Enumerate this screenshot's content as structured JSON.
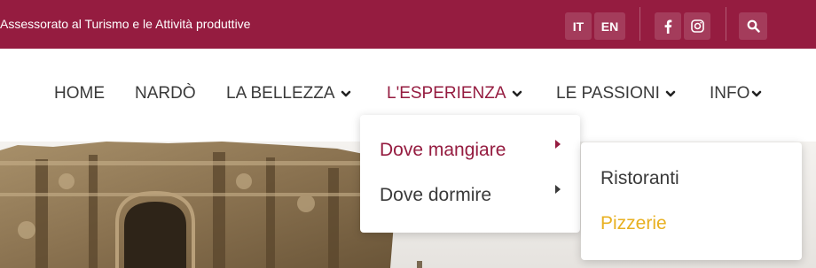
{
  "topbar": {
    "title": "Assessorato al Turismo e le Attività produttive",
    "lang_it": "IT",
    "lang_en": "EN",
    "icons": [
      "facebook-icon",
      "instagram-icon",
      "search-icon"
    ],
    "bg_color": "#951c40"
  },
  "nav": {
    "items": [
      {
        "label": "HOME"
      },
      {
        "label": "NARDÒ"
      },
      {
        "label": "LA BELLEZZA",
        "has_dropdown": true
      },
      {
        "label": "L'ESPERIENZA",
        "has_dropdown": true,
        "active": true
      },
      {
        "label": "LE PASSIONI",
        "has_dropdown": true
      },
      {
        "label": "INFO",
        "has_dropdown": true
      }
    ]
  },
  "submenu": {
    "items": [
      {
        "label": "Dove mangiare",
        "active": true
      },
      {
        "label": "Dove dormire"
      }
    ]
  },
  "subsubmenu": {
    "items": [
      {
        "label": "Ristoranti"
      },
      {
        "label": "Pizzerie",
        "hovered": true
      }
    ]
  },
  "colors": {
    "accent": "#951c40",
    "hover": "#e8b020",
    "text": "#3a3a3a"
  }
}
